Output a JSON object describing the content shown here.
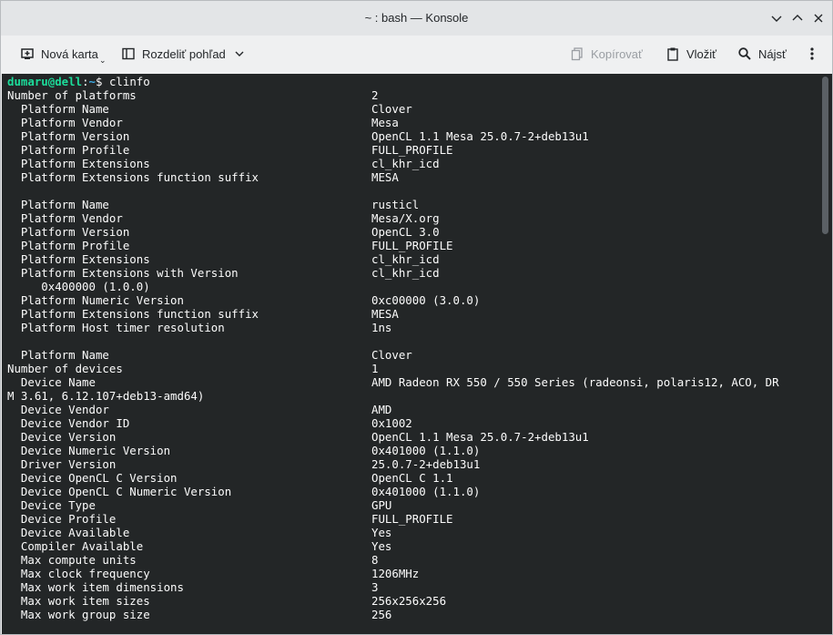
{
  "window": {
    "title": "~ : bash — Konsole"
  },
  "toolbar": {
    "new_tab": "Nová karta",
    "split_view": "Rozdeliť pohľad",
    "copy": "Kopírovať",
    "paste": "Vložiť",
    "find": "Nájsť"
  },
  "prompt": {
    "user_host": "dumaru@dell",
    "separator": ":",
    "path": "~",
    "symbol": "$",
    "command": "clinfo"
  },
  "output": [
    {
      "k": "Number of platforms",
      "v": "2"
    },
    {
      "k": "  Platform Name",
      "v": "Clover"
    },
    {
      "k": "  Platform Vendor",
      "v": "Mesa"
    },
    {
      "k": "  Platform Version",
      "v": "OpenCL 1.1 Mesa 25.0.7-2+deb13u1"
    },
    {
      "k": "  Platform Profile",
      "v": "FULL_PROFILE"
    },
    {
      "k": "  Platform Extensions",
      "v": "cl_khr_icd"
    },
    {
      "k": "  Platform Extensions function suffix",
      "v": "MESA"
    },
    {
      "k": "",
      "v": ""
    },
    {
      "k": "  Platform Name",
      "v": "rusticl"
    },
    {
      "k": "  Platform Vendor",
      "v": "Mesa/X.org"
    },
    {
      "k": "  Platform Version",
      "v": "OpenCL 3.0"
    },
    {
      "k": "  Platform Profile",
      "v": "FULL_PROFILE"
    },
    {
      "k": "  Platform Extensions",
      "v": "cl_khr_icd"
    },
    {
      "k": "  Platform Extensions with Version",
      "v": "cl_khr_icd"
    },
    {
      "k": "     0x400000 (1.0.0)",
      "v": ""
    },
    {
      "k": "  Platform Numeric Version",
      "v": "0xc00000 (3.0.0)"
    },
    {
      "k": "  Platform Extensions function suffix",
      "v": "MESA"
    },
    {
      "k": "  Platform Host timer resolution",
      "v": "1ns"
    },
    {
      "k": "",
      "v": ""
    },
    {
      "k": "  Platform Name",
      "v": "Clover"
    },
    {
      "k": "Number of devices",
      "v": "1"
    },
    {
      "k": "  Device Name",
      "v": "AMD Radeon RX 550 / 550 Series (radeonsi, polaris12, ACO, DR"
    },
    {
      "k": "M 3.61, 6.12.107+deb13-amd64)",
      "v": ""
    },
    {
      "k": "  Device Vendor",
      "v": "AMD"
    },
    {
      "k": "  Device Vendor ID",
      "v": "0x1002"
    },
    {
      "k": "  Device Version",
      "v": "OpenCL 1.1 Mesa 25.0.7-2+deb13u1"
    },
    {
      "k": "  Device Numeric Version",
      "v": "0x401000 (1.1.0)"
    },
    {
      "k": "  Driver Version",
      "v": "25.0.7-2+deb13u1"
    },
    {
      "k": "  Device OpenCL C Version",
      "v": "OpenCL C 1.1"
    },
    {
      "k": "  Device OpenCL C Numeric Version",
      "v": "0x401000 (1.1.0)"
    },
    {
      "k": "  Device Type",
      "v": "GPU"
    },
    {
      "k": "  Device Profile",
      "v": "FULL_PROFILE"
    },
    {
      "k": "  Device Available",
      "v": "Yes"
    },
    {
      "k": "  Compiler Available",
      "v": "Yes"
    },
    {
      "k": "  Max compute units",
      "v": "8"
    },
    {
      "k": "  Max clock frequency",
      "v": "1206MHz"
    },
    {
      "k": "  Max work item dimensions",
      "v": "3"
    },
    {
      "k": "  Max work item sizes",
      "v": "256x256x256"
    },
    {
      "k": "  Max work group size",
      "v": "256"
    }
  ],
  "icons": [
    "new-tab-icon",
    "split-view-icon",
    "chevron-down-icon",
    "copy-icon",
    "paste-icon",
    "search-icon",
    "kebab-menu-icon",
    "minimize-icon",
    "maximize-icon",
    "close-icon"
  ],
  "colors": {
    "terminal_bg": "#232627",
    "terminal_fg": "#fcfcfc",
    "prompt_user": "#1cdc9a",
    "prompt_path": "#3daee9"
  }
}
